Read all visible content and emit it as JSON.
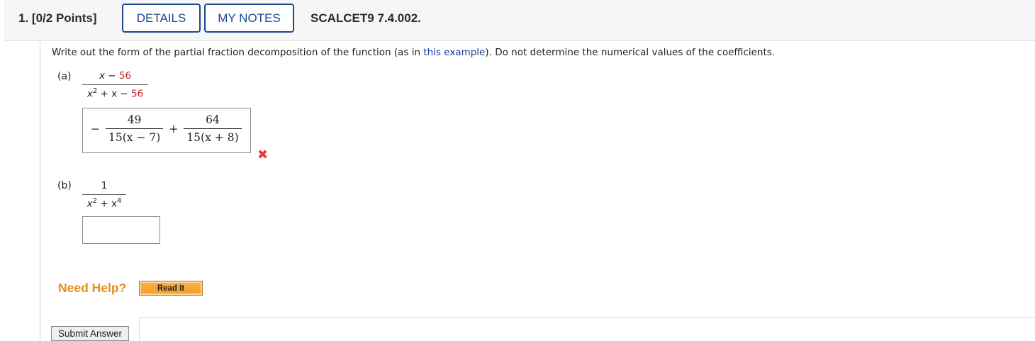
{
  "header": {
    "question_number": "1.",
    "points": "[0/2 Points]",
    "details_label": "DETAILS",
    "my_notes_label": "MY NOTES",
    "question_id": "SCALCET9 7.4.002."
  },
  "instructions": {
    "before_link": "Write out the form of the partial fraction decomposition of the function (as in ",
    "link_text": "this example",
    "after_link": "). Do not determine the numerical values of the coefficients."
  },
  "part_a": {
    "label": "(a)",
    "numerator_var": "x",
    "numerator_op": " − ",
    "numerator_const": "56",
    "denominator_base": "x",
    "denominator_exp": "2",
    "denominator_mid": " + x − ",
    "denominator_const": "56",
    "answer": {
      "sign1": "−",
      "frac1_num": "49",
      "frac1_den_coef": "15",
      "frac1_den_inner": "x − 7",
      "sign2": "+",
      "frac2_num": "64",
      "frac2_den_coef": "15",
      "frac2_den_inner": "x + 8"
    },
    "status_icon": "incorrect-x-icon",
    "status_glyph": "✖"
  },
  "part_b": {
    "label": "(b)",
    "numerator": "1",
    "den_base1": "x",
    "den_exp1": "2",
    "den_mid": " + x",
    "den_exp2": "4",
    "answer_value": ""
  },
  "help": {
    "need_help_label": "Need Help?",
    "read_it_label": "Read It"
  },
  "submit_label": "Submit Answer",
  "colors": {
    "accent_blue": "#1d4a8f",
    "error_red": "#e5393b",
    "help_orange": "#ea8c1a",
    "value_red": "#c81e1e"
  }
}
